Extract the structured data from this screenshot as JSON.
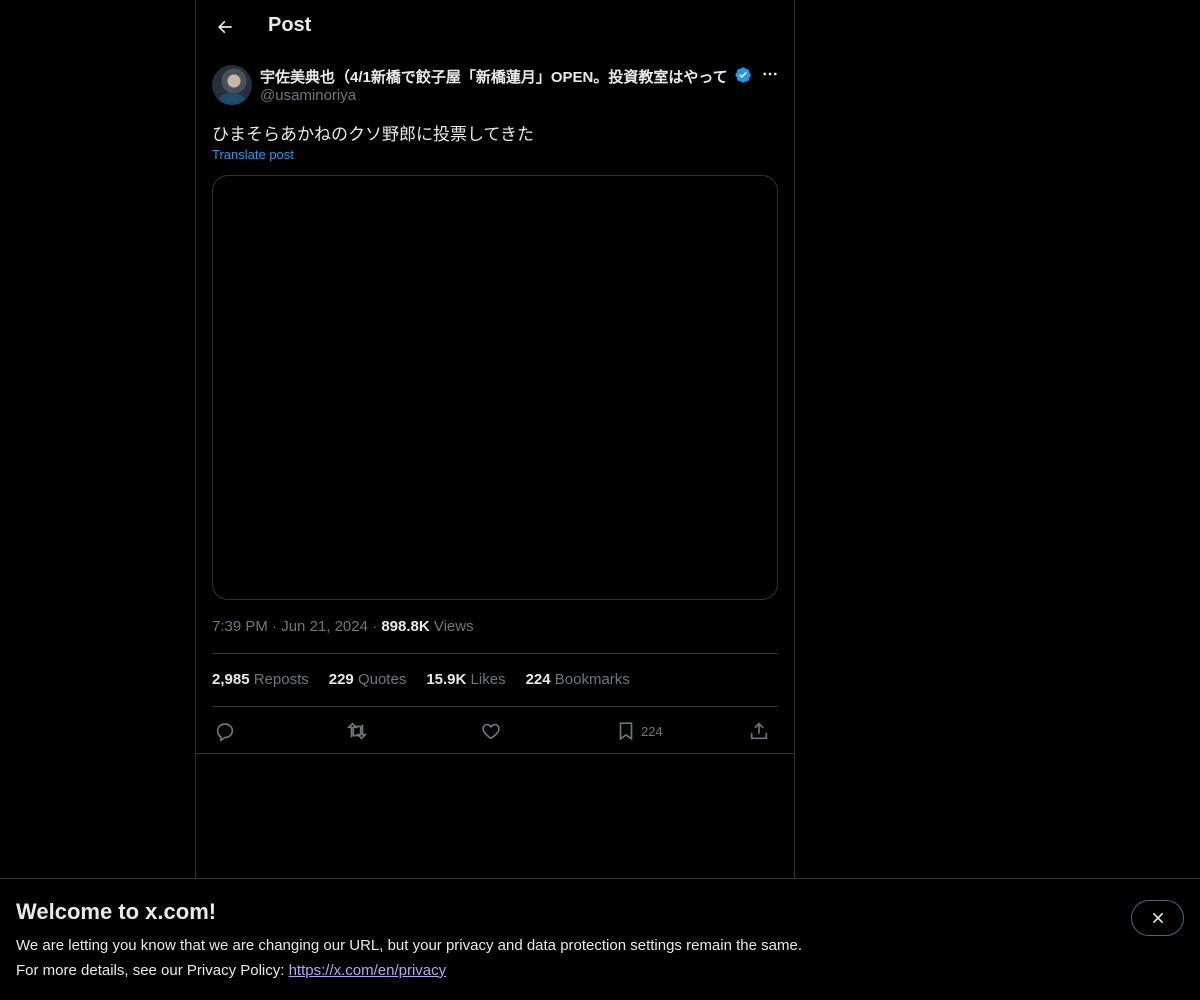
{
  "header": {
    "title": "Post"
  },
  "post": {
    "author": {
      "display_name": "宇佐美典也（4/1新橋で餃子屋「新橋蓮月」OPEN。投資教室はやって",
      "handle": "@usaminoriya"
    },
    "text": "ひまそらあかねのクソ野郎に投票してきた",
    "translate_label": "Translate post",
    "time": "7:39 PM",
    "date": "Jun 21, 2024",
    "views_count": "898.8K",
    "views_label": "Views",
    "stats": {
      "reposts_count": "2,985",
      "reposts_label": "Reposts",
      "quotes_count": "229",
      "quotes_label": "Quotes",
      "likes_count": "15.9K",
      "likes_label": "Likes",
      "bookmarks_count": "224",
      "bookmarks_label": "Bookmarks"
    },
    "actions": {
      "bookmark_count": "224"
    }
  },
  "banner": {
    "title": "Welcome to x.com!",
    "line1": "We are letting you know that we are changing our URL, but your privacy and data protection settings remain the same.",
    "line2_prefix": "For more details, see our Privacy Policy: ",
    "link": "https://x.com/en/privacy"
  },
  "colors": {
    "background": "#000000",
    "accent": "#1d9bf0",
    "border": "#2f3336",
    "muted": "#71767b"
  },
  "icons": [
    "back-arrow-icon",
    "verified-badge-icon",
    "more-icon",
    "reply-icon",
    "repost-icon",
    "like-icon",
    "bookmark-icon",
    "share-icon",
    "close-icon"
  ]
}
